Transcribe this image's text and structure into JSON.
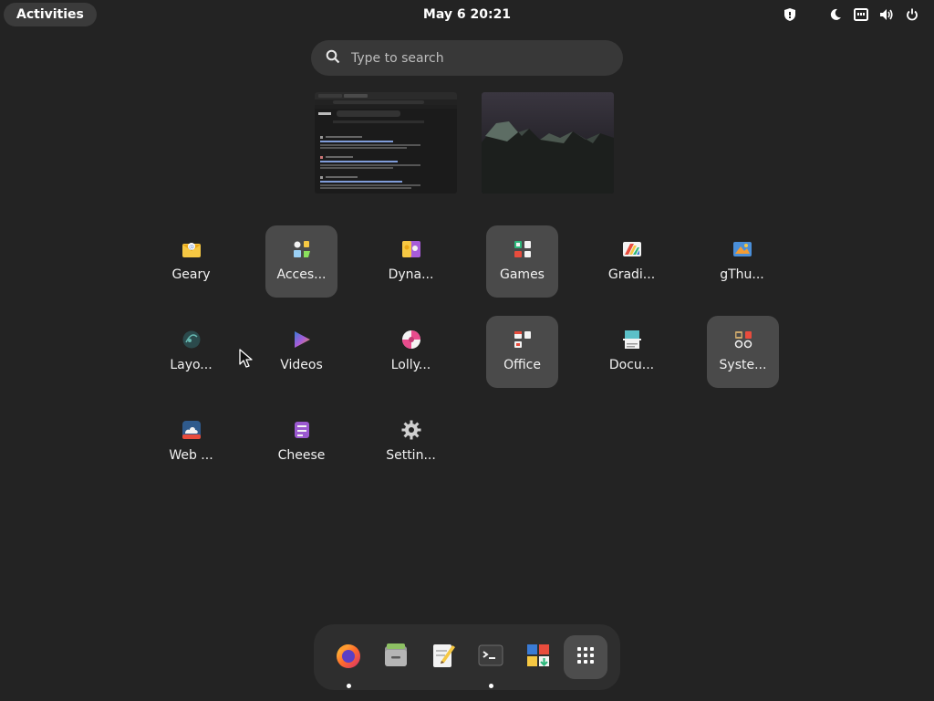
{
  "topbar": {
    "activities_label": "Activities",
    "clock": "May 6  20:21",
    "status_icons": [
      "shield-icon",
      "night-light-icon",
      "network-icon",
      "volume-icon",
      "power-icon"
    ]
  },
  "search": {
    "placeholder": "Type to search"
  },
  "workspaces": [
    {
      "name": "workspace-1-thumbnail"
    },
    {
      "name": "workspace-2-thumbnail"
    }
  ],
  "apps": [
    {
      "label": "Geary",
      "icon": "geary-icon",
      "folder": false
    },
    {
      "label": "Acces...",
      "icon": "accessories-folder-icon",
      "folder": true
    },
    {
      "label": "Dyna...",
      "icon": "dynamic-wallpaper-icon",
      "folder": false
    },
    {
      "label": "Games",
      "icon": "games-folder-icon",
      "folder": true
    },
    {
      "label": "Gradi...",
      "icon": "gradience-icon",
      "folder": false
    },
    {
      "label": "gThu...",
      "icon": "gthumb-icon",
      "folder": false
    },
    {
      "label": "Layo...",
      "icon": "layout-icon",
      "folder": false
    },
    {
      "label": "Videos",
      "icon": "videos-icon",
      "folder": false
    },
    {
      "label": "Lolly...",
      "icon": "lollypop-icon",
      "folder": false
    },
    {
      "label": "Office",
      "icon": "office-folder-icon",
      "folder": true
    },
    {
      "label": "Docu...",
      "icon": "document-scanner-icon",
      "folder": false
    },
    {
      "label": "Syste...",
      "icon": "system-folder-icon",
      "folder": true
    },
    {
      "label": "Web ...",
      "icon": "web-icon",
      "folder": false
    },
    {
      "label": "Cheese",
      "icon": "cheese-icon",
      "folder": false
    },
    {
      "label": "Settin...",
      "icon": "settings-gear-icon",
      "folder": false
    }
  ],
  "dock": [
    {
      "icon": "firefox-icon",
      "running": true
    },
    {
      "icon": "files-icon",
      "running": false
    },
    {
      "icon": "text-editor-icon",
      "running": false
    },
    {
      "icon": "terminal-icon",
      "running": true
    },
    {
      "icon": "software-icon",
      "running": false
    },
    {
      "icon": "show-apps-grid-icon",
      "running": false
    }
  ]
}
